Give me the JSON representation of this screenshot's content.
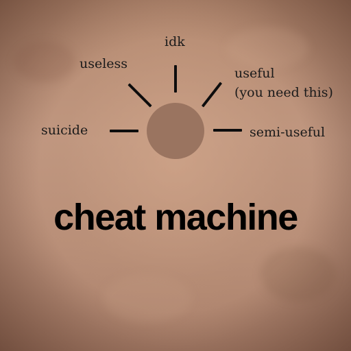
{
  "title": "cheat machine",
  "options": {
    "idk": "idk",
    "useless": "useless",
    "useful_line1": "useful",
    "useful_line2": "(you need this)",
    "suicide": "suicide",
    "semi_useful": "semi-useful"
  },
  "colors": {
    "background": "#bd927c",
    "dial": "#9a7460",
    "ray": "#0d0d0d",
    "text": "#1a1a1a"
  }
}
